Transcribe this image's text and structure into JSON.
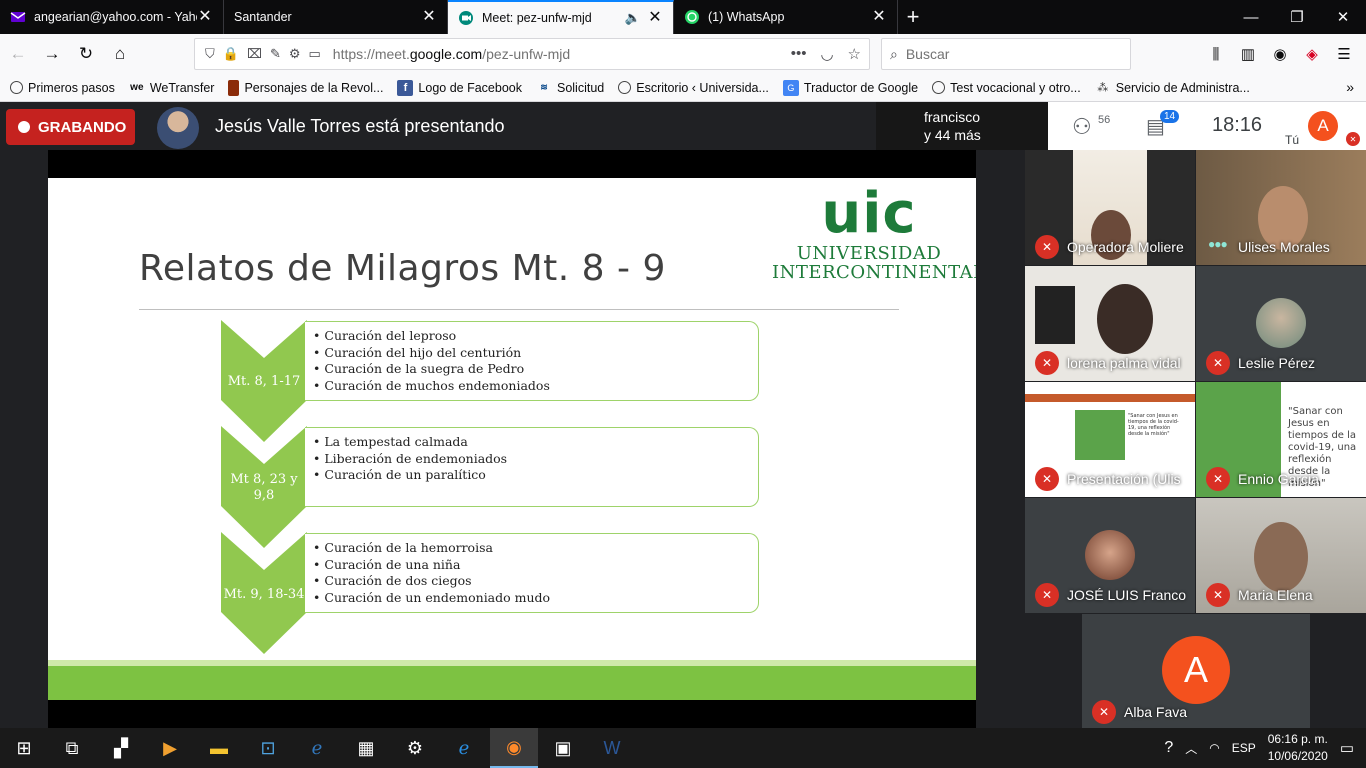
{
  "browser": {
    "tabs": [
      {
        "title": "angearian@yahoo.com - Yahoo",
        "icon": "yahoo-mail-icon",
        "color": "#6001d2"
      },
      {
        "title": "Santander",
        "icon": "",
        "color": ""
      },
      {
        "title": "Meet: pez-unfw-mjd",
        "icon": "google-meet-icon",
        "color": "#00897b"
      },
      {
        "title": "(1) WhatsApp",
        "icon": "whatsapp-icon",
        "color": "#25d366"
      }
    ],
    "url_prefix": "https://meet.",
    "url_domain": "google.com",
    "url_suffix": "/pez-unfw-mjd",
    "search_placeholder": "Buscar"
  },
  "bookmarks": [
    {
      "label": "Primeros pasos",
      "icon": "globe-icon"
    },
    {
      "label": "WeTransfer",
      "icon": "wetransfer-icon"
    },
    {
      "label": "Personajes de la Revol...",
      "icon": "book-icon"
    },
    {
      "label": "Logo de Facebook",
      "icon": "facebook-icon"
    },
    {
      "label": "Solicitud",
      "icon": "imss-icon"
    },
    {
      "label": "Escritorio ‹ Universida...",
      "icon": "globe-icon"
    },
    {
      "label": "Traductor de Google",
      "icon": "google-translate-icon"
    },
    {
      "label": "Test vocacional y otro...",
      "icon": "globe-icon"
    },
    {
      "label": "Servicio de Administra...",
      "icon": "sat-icon"
    }
  ],
  "meet": {
    "recording_label": "GRABANDO",
    "presenting_text": "Jesús Valle Torres está presentando",
    "others_line1": "francisco",
    "others_line2": "y 44 más",
    "people_count": "56",
    "chat_count": "14",
    "clock": "18:16",
    "self_label": "Tú",
    "self_initial": "A"
  },
  "slide": {
    "title": "Relatos de Milagros Mt. 8 - 9",
    "logo_big": "uic",
    "logo_line1": "UNIVERSIDAD",
    "logo_line2": "INTERCONTINENTAL",
    "groups": [
      {
        "label": "Mt. 8, 1-17",
        "items": [
          "Curación del leproso",
          "Curación del hijo del centurión",
          "Curación de la suegra de Pedro",
          "Curación de muchos endemoniados"
        ]
      },
      {
        "label": "Mt  8, 23 y 9,8",
        "items": [
          "La tempestad calmada",
          "Liberación de endemoniados",
          "Curación de un paralítico"
        ]
      },
      {
        "label": "Mt. 9, 18-34",
        "items": [
          "Curación de la hemorroisa",
          "Curación de una niña",
          "Curación de dos ciegos",
          "Curación de un endemoniado mudo"
        ]
      }
    ]
  },
  "participants": [
    {
      "name": "Operadora Moliere",
      "mic": "off"
    },
    {
      "name": "Ulises Morales",
      "mic": "speaking"
    },
    {
      "name": "lorena palma vidal",
      "mic": "off"
    },
    {
      "name": "Leslie Pérez",
      "mic": "off"
    },
    {
      "name": "Presentación  (Ulis",
      "mic": "off"
    },
    {
      "name": "Ennio Garcia",
      "mic": "off"
    },
    {
      "name": "JOSÉ LUIS Franco",
      "mic": "off"
    },
    {
      "name": "Maria Elena",
      "mic": "off"
    },
    {
      "name": "Alba Fava",
      "mic": "off",
      "initial": "A"
    }
  ],
  "share_preview_text": "\"Sanar con Jesus en tiempos de la covid-19, una reflexión desde la misión\"",
  "taskbar": {
    "language": "ESP",
    "time": "06:16 p. m.",
    "date": "10/06/2020"
  },
  "colors": {
    "accent_green": "#7dc242",
    "uic_green": "#1e7b3a",
    "recording_red": "#c5221f",
    "meet_bg": "#202124"
  }
}
